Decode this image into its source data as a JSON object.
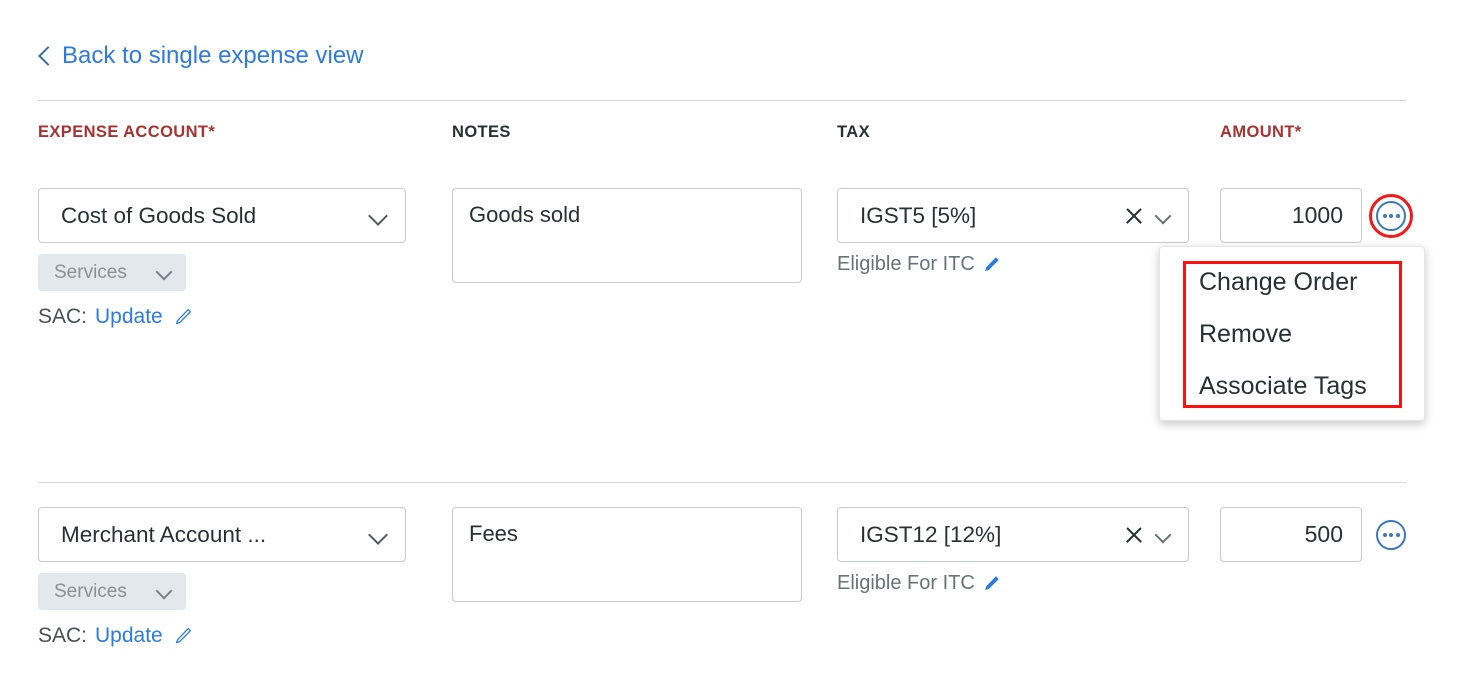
{
  "back_link": {
    "label": "Back to single expense view",
    "icon": "chevron-left-icon",
    "color": "#2c7be5"
  },
  "table": {
    "headers": [
      {
        "label": "EXPENSE ACCOUNT*",
        "required": true
      },
      {
        "label": "NOTES",
        "required": false
      },
      {
        "label": "TAX",
        "required": false
      },
      {
        "label": "AMOUNT*",
        "required": true
      }
    ],
    "rows": [
      {
        "account": "Cost of Goods Sold",
        "account_chevron": "chevron-down-icon",
        "chip": "Services",
        "chip_chevron": "chevron-down-icon",
        "sac_label": "SAC:",
        "sac_action": "Update",
        "sac_icon": "pencil-outline-icon",
        "notes": "Goods sold",
        "tax": "IGST5 [5%]",
        "tax_clear_icon": "close-icon",
        "tax_chevron": "chevron-down-icon",
        "itc": "Eligible For ITC",
        "itc_icon": "pencil-solid-icon",
        "amount": "1000",
        "more_icon": "ellipsis-icon",
        "annotated": true
      },
      {
        "account": "Merchant Account ...",
        "account_chevron": "chevron-down-icon",
        "chip": "Services",
        "chip_chevron": "chevron-down-icon",
        "sac_label": "SAC:",
        "sac_action": "Update",
        "sac_icon": "pencil-outline-icon",
        "notes": "Fees",
        "tax": "IGST12 [12%]",
        "tax_clear_icon": "close-icon",
        "tax_chevron": "chevron-down-icon",
        "itc": "Eligible For ITC",
        "itc_icon": "pencil-solid-icon",
        "amount": "500",
        "more_icon": "ellipsis-icon",
        "annotated": false
      }
    ]
  },
  "context_menu": {
    "visible": true,
    "items": [
      {
        "label": "Change Order"
      },
      {
        "label": "Remove"
      },
      {
        "label": "Associate Tags"
      }
    ],
    "highlight_color": "#fa1010"
  },
  "colors": {
    "link": "#2c7be5",
    "required_header": "#a83232",
    "annotation": "#fa1010",
    "chip_bg": "#e2e8ee",
    "border": "#c7cbcf"
  }
}
